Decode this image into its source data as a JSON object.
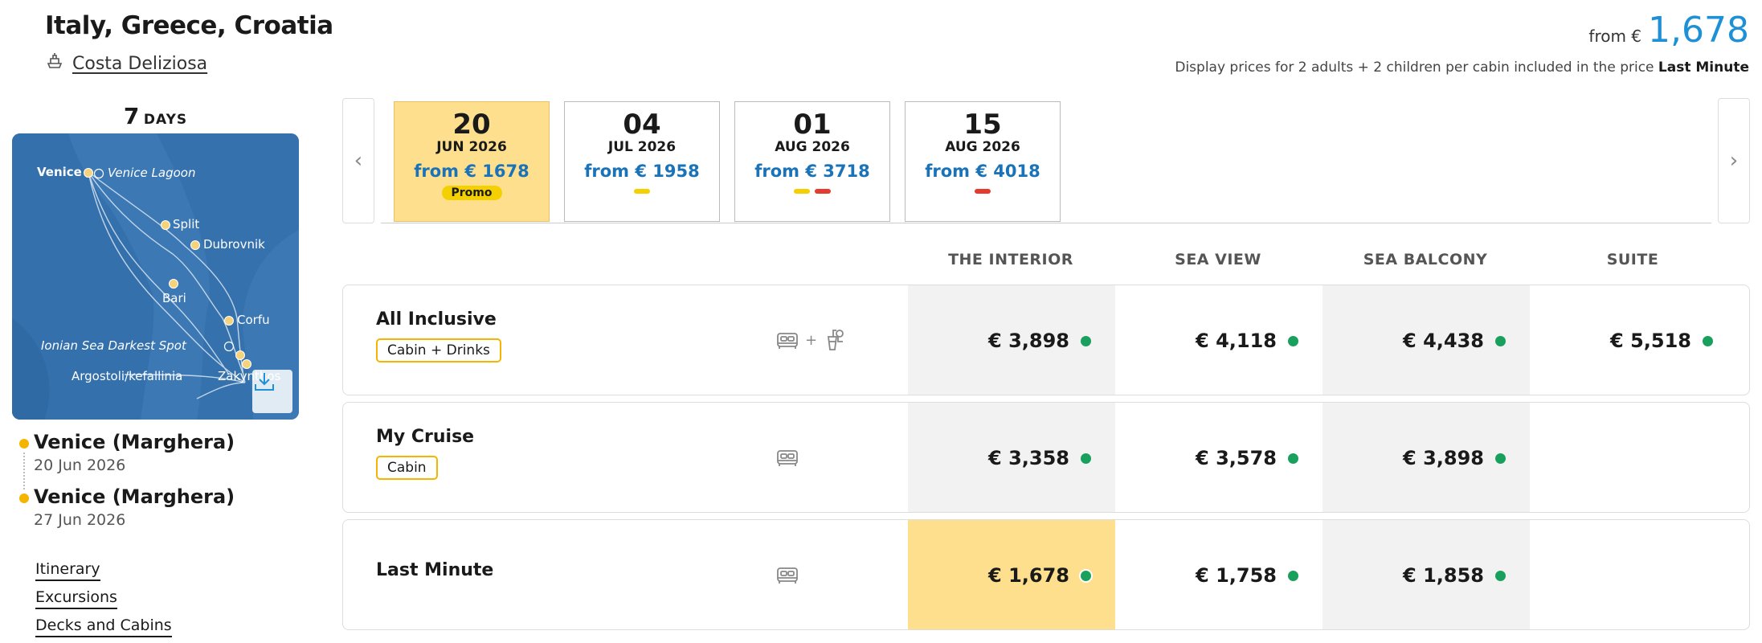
{
  "header": {
    "title": "Italy, Greece, Croatia",
    "ship_name": "Costa Deliziosa",
    "from_label": "from €",
    "from_price": "1,678",
    "display_note_prefix": "Display prices for 2 adults + 2 children per cabin included in the price",
    "display_note_bold": "Last Minute"
  },
  "itinerary": {
    "days_num": "7",
    "days_label": "DAYS",
    "map_labels": {
      "venice": "Venice",
      "venice_lagoon": "Venice Lagoon",
      "split": "Split",
      "dubrovnik": "Dubrovnik",
      "bari": "Bari",
      "corfu": "Corfu",
      "ionian": "Ionian Sea Darkest Spot",
      "argostoli": "Argostoli/kefallinia",
      "zakynthos": "Zakynthos"
    },
    "departure": {
      "port": "Venice (Marghera)",
      "date": "20 Jun 2026"
    },
    "arrival": {
      "port": "Venice (Marghera)",
      "date": "27 Jun 2026"
    },
    "links": [
      "Itinerary",
      "Excursions",
      "Decks and Cabins"
    ]
  },
  "dates": [
    {
      "day": "20",
      "month": "JUN 2026",
      "price": "from € 1678",
      "badge": "Promo",
      "flags": [],
      "active": true
    },
    {
      "day": "04",
      "month": "JUL 2026",
      "price": "from € 1958",
      "badge": "",
      "flags": [
        "yellow"
      ],
      "active": false
    },
    {
      "day": "01",
      "month": "AUG 2026",
      "price": "from € 3718",
      "badge": "",
      "flags": [
        "yellow",
        "red"
      ],
      "active": false
    },
    {
      "day": "15",
      "month": "AUG 2026",
      "price": "from € 4018",
      "badge": "",
      "flags": [
        "red"
      ],
      "active": false
    }
  ],
  "columns": [
    "THE INTERIOR",
    "SEA VIEW",
    "SEA BALCONY",
    "SUITE"
  ],
  "fares": [
    {
      "name": "All Inclusive",
      "tag": "Cabin + Drinks",
      "icons": "bed+drinks",
      "plus": "+",
      "prices": [
        "€ 3,898",
        "€ 4,118",
        "€ 4,438",
        "€ 5,518"
      ]
    },
    {
      "name": "My Cruise",
      "tag": "Cabin",
      "icons": "bed",
      "prices": [
        "€ 3,358",
        "€ 3,578",
        "€ 3,898",
        ""
      ]
    },
    {
      "name": "Last Minute",
      "tag": "",
      "icons": "bed",
      "prices": [
        "€ 1,678",
        "€ 1,758",
        "€ 1,858",
        ""
      ]
    }
  ],
  "colors": {
    "accent_blue": "#1e90d6",
    "highlight": "#fddf8e",
    "available": "#19a05c",
    "tag_border": "#f5b400"
  }
}
